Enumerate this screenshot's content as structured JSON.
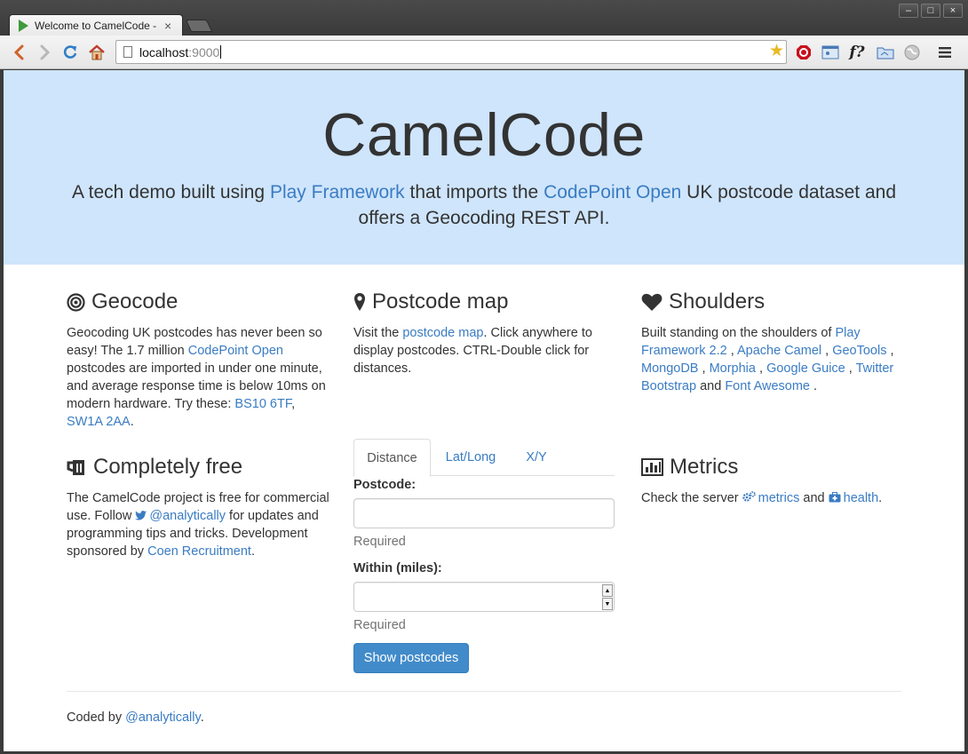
{
  "browser": {
    "tab_title": "Welcome to CamelCode -",
    "tab_close": "×",
    "url_host": "localhost",
    "url_port": ":9000",
    "window_buttons": [
      "‒",
      "□",
      "×"
    ]
  },
  "hero": {
    "title": "CamelCode",
    "lead_1": "A tech demo built using ",
    "lead_link_1": "Play Framework",
    "lead_2": " that imports the ",
    "lead_link_2": "CodePoint Open",
    "lead_3": " UK postcode dataset and offers a Geocoding REST API."
  },
  "geocode": {
    "heading": "Geocode",
    "text_1": "Geocoding UK postcodes has never been so easy! The 1.7 million ",
    "link_1": "CodePoint Open",
    "text_2": " postcodes are imported in under one minute, and average response time is below 10ms on modern hardware. Try these: ",
    "link_2": "BS10 6TF",
    "text_3": ", ",
    "link_3": "SW1A 2AA",
    "text_4": "."
  },
  "postcode_map": {
    "heading": "Postcode map",
    "text_1": "Visit the ",
    "link_1": "postcode map",
    "text_2": ". Click anywhere to display postcodes. CTRL-Double click for distances."
  },
  "shoulders": {
    "heading": "Shoulders",
    "text_1": "Built standing on the shoulders of ",
    "links": [
      "Play Framework 2.2",
      "Apache Camel",
      "GeoTools",
      "MongoDB",
      "Morphia",
      "Google Guice",
      "Twitter Bootstrap",
      "Font Awesome"
    ],
    "sep": " , ",
    "and": " and ",
    "end": " ."
  },
  "free": {
    "heading": "Completely free",
    "text_1": "The CamelCode project is free for commercial use. Follow ",
    "link_1": "@analytically",
    "text_2": " for updates and programming tips and tricks. Development sponsored by ",
    "link_2": "Coen Recruitment",
    "text_3": "."
  },
  "form": {
    "tabs": [
      "Distance",
      "Lat/Long",
      "X/Y"
    ],
    "postcode_label": "Postcode:",
    "postcode_value": "",
    "postcode_help": "Required",
    "within_label": "Within (miles):",
    "within_value": "",
    "within_help": "Required",
    "submit_label": "Show postcodes"
  },
  "metrics": {
    "heading": "Metrics",
    "text_1": "Check the server ",
    "link_1": "metrics",
    "text_2": " and ",
    "link_2": "health",
    "text_3": "."
  },
  "footer": {
    "text_1": "Coded by ",
    "link_1": "@analytically",
    "text_2": "."
  },
  "colors": {
    "hero_bg": "#cfe5fc",
    "link": "#3a7cc3",
    "primary_button": "#428bca"
  }
}
